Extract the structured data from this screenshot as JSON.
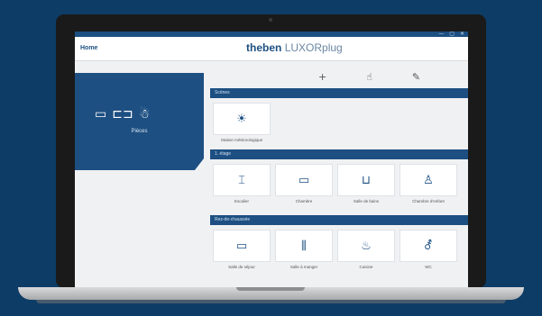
{
  "window": {
    "controls": [
      "—",
      "▢",
      "✕"
    ]
  },
  "appbar": {
    "home_label": "Home",
    "brand_name": "theben",
    "brand_product": "LUXORplug"
  },
  "nav": {
    "label": "Pièces",
    "icons": [
      "tv-icon",
      "bed-icon",
      "person-icon"
    ],
    "glyphs": [
      "▭",
      "⊏⊐",
      "☃"
    ]
  },
  "toolbar": {
    "icons": [
      "plus-icon",
      "hand-icon",
      "pencil-icon"
    ],
    "glyphs": [
      "+",
      "☝",
      "✎"
    ]
  },
  "sections": [
    {
      "title": "Scènes",
      "items": [
        {
          "label": "Station météorologique",
          "icon": "weather-station-icon",
          "glyph": "☀"
        }
      ]
    },
    {
      "title": "1. étage",
      "items": [
        {
          "label": "Escalier",
          "icon": "staircase-icon",
          "glyph": "⌶"
        },
        {
          "label": "Chambre",
          "icon": "bed-icon",
          "glyph": "▭"
        },
        {
          "label": "Salle de bains",
          "icon": "bathtub-icon",
          "glyph": "⊔"
        },
        {
          "label": "Chambre d'enfant",
          "icon": "child-icon",
          "glyph": "♙"
        }
      ]
    },
    {
      "title": "Rez-de-chaussée",
      "items": [
        {
          "label": "Salle de séjour",
          "icon": "tv-icon",
          "glyph": "▭"
        },
        {
          "label": "Salle à manger",
          "icon": "cutlery-icon",
          "glyph": "⫼"
        },
        {
          "label": "Cuisine",
          "icon": "kitchen-icon",
          "glyph": "♨"
        },
        {
          "label": "WC",
          "icon": "wc-icon",
          "glyph": "⚦"
        }
      ]
    }
  ],
  "colors": {
    "background": "#0d3d66",
    "accent": "#1d4f82",
    "tile_bg": "#ffffff",
    "screen_bg": "#f0f1f3"
  }
}
